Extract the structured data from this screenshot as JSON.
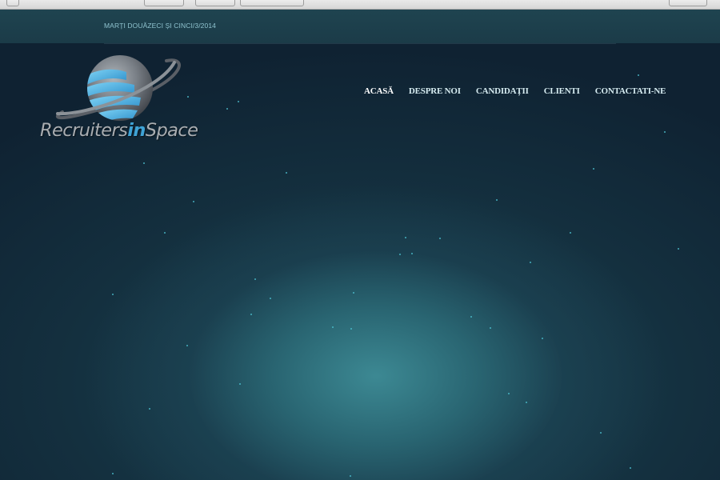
{
  "header": {
    "date": "MARȚI DOUĂZECI ȘI CINCI/3/2014"
  },
  "logo": {
    "text_part1": "Recruiters",
    "text_part2": "in",
    "text_part3": "Space"
  },
  "nav": {
    "items": [
      {
        "label": "ACASĂ"
      },
      {
        "label": "DESPRE NOI"
      },
      {
        "label": "CANDIDAȚII"
      },
      {
        "label": "CLIENTI"
      },
      {
        "label": "CONTACTATI-NE"
      }
    ]
  },
  "colors": {
    "background": "#0f2232",
    "glow": "#3e8c96",
    "accent": "#3fa3d6",
    "star": "#4fc4d4"
  }
}
